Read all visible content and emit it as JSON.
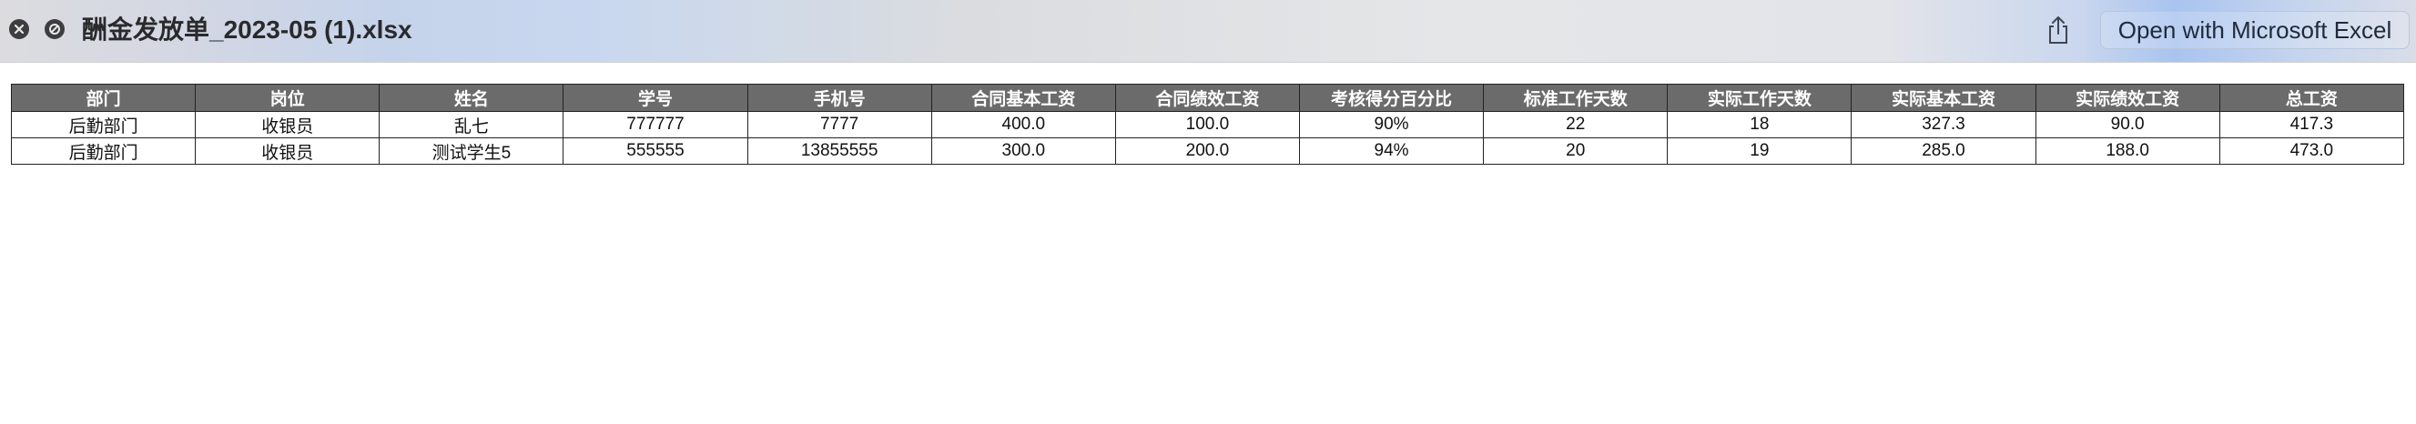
{
  "window": {
    "title": "酬金发放单_2023-05 (1).xlsx",
    "open_button_label": "Open with Microsoft Excel",
    "icons": {
      "close": "close-icon",
      "block": "block-icon",
      "share": "share-icon"
    }
  },
  "sheet": {
    "headers": [
      "部门",
      "岗位",
      "姓名",
      "学号",
      "手机号",
      "合同基本工资",
      "合同绩效工资",
      "考核得分百分比",
      "标准工作天数",
      "实际工作天数",
      "实际基本工资",
      "实际绩效工资",
      "总工资"
    ],
    "rows": [
      [
        "后勤部门",
        "收银员",
        "乱七",
        "777777",
        "7777",
        "400.0",
        "100.0",
        "90%",
        "22",
        "18",
        "327.3",
        "90.0",
        "417.3"
      ],
      [
        "后勤部门",
        "收银员",
        "测试学生5",
        "555555",
        "13855555",
        "300.0",
        "200.0",
        "94%",
        "20",
        "19",
        "285.0",
        "188.0",
        "473.0"
      ]
    ]
  },
  "colors": {
    "header_bg": "#6b6b6b",
    "header_text": "#ffffff",
    "grid": "#222222"
  }
}
